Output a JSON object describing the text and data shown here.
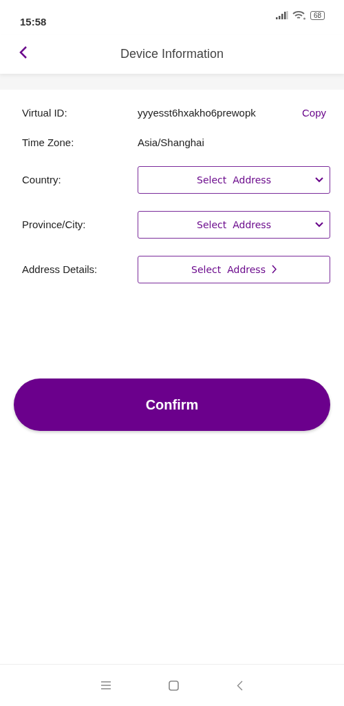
{
  "status_bar": {
    "time": "15:58",
    "battery": "68"
  },
  "header": {
    "title": "Device Information"
  },
  "rows": [
    {
      "kind": "text",
      "label": "Virtual ID:",
      "value": "yyyesst6hxakho6prewopk",
      "action": "Copy"
    },
    {
      "kind": "text",
      "label": "Time Zone:",
      "value": "Asia/Shanghai"
    },
    {
      "kind": "dropdown",
      "label": "Country:",
      "value": "Select  Address"
    },
    {
      "kind": "dropdown",
      "label": "Province/City:",
      "value": "Select  Address"
    },
    {
      "kind": "link",
      "label": "Address Details:",
      "value": "Select  Address"
    }
  ],
  "confirm_button": "Confirm"
}
